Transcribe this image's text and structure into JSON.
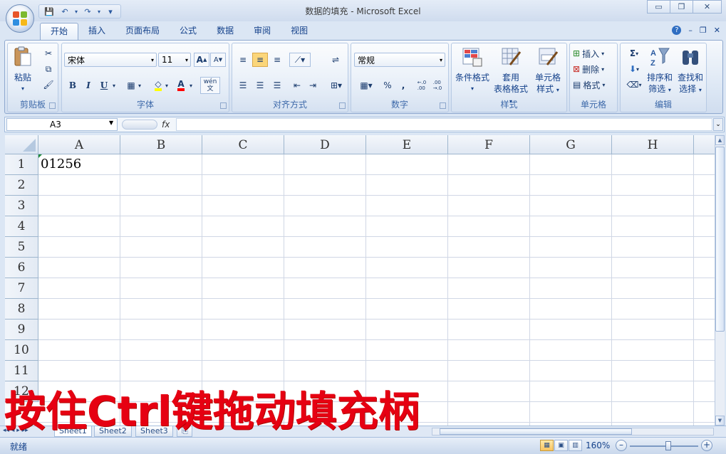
{
  "window": {
    "title": "数据的填充 - Microsoft Excel",
    "controls": {
      "minimize": "▭",
      "restore": "❐",
      "close": "✕"
    }
  },
  "qat": {
    "save": "💾",
    "undo": "↶",
    "redo": "↷",
    "customize": "▾"
  },
  "ribbon_tabs": [
    "开始",
    "插入",
    "页面布局",
    "公式",
    "数据",
    "审阅",
    "视图"
  ],
  "ribbon_right": {
    "help": "?",
    "minimize": "–",
    "restore": "❐",
    "close": "✕"
  },
  "clipboard": {
    "label": "剪贴板",
    "paste": "粘贴"
  },
  "font": {
    "label": "字体",
    "font_name": "宋体",
    "font_size": "11",
    "bold": "B",
    "italic": "I",
    "underline": "U",
    "grow": "A",
    "shrink": "A",
    "wen": "wén\n文"
  },
  "alignment": {
    "label": "对齐方式"
  },
  "number": {
    "label": "数字",
    "format": "常规",
    "percent": "%",
    "comma": ",",
    "inc_decimal": "←.0\n.00",
    "dec_decimal": ".00\n→.0"
  },
  "styles": {
    "label": "样式",
    "conditional": "条件格式",
    "table_format_1": "套用",
    "table_format_2": "表格格式",
    "cell_style_1": "单元格",
    "cell_style_2": "样式"
  },
  "cells": {
    "label": "单元格",
    "insert": "插入",
    "delete": "删除",
    "format": "格式"
  },
  "editing": {
    "label": "编辑",
    "sum": "Σ",
    "sort_1": "排序和",
    "sort_2": "筛选",
    "find_1": "查找和",
    "find_2": "选择"
  },
  "formula_bar": {
    "name_box": "A3",
    "fx": "fx",
    "value": ""
  },
  "columns": [
    "A",
    "B",
    "C",
    "D",
    "E",
    "F",
    "G",
    "H"
  ],
  "rows": [
    "1",
    "2",
    "3",
    "4",
    "5",
    "6",
    "7",
    "8",
    "9",
    "10",
    "11",
    "12"
  ],
  "cell_a1": "01256",
  "sheets": [
    "Sheet1",
    "Sheet2",
    "Sheet3"
  ],
  "status": {
    "text": "就绪",
    "zoom": "160%"
  },
  "caption": "按住Ctrl键拖动填充柄",
  "colors": {
    "accent": "#15428b",
    "caption": "#e60012",
    "grid_line": "#d0d7e5"
  }
}
